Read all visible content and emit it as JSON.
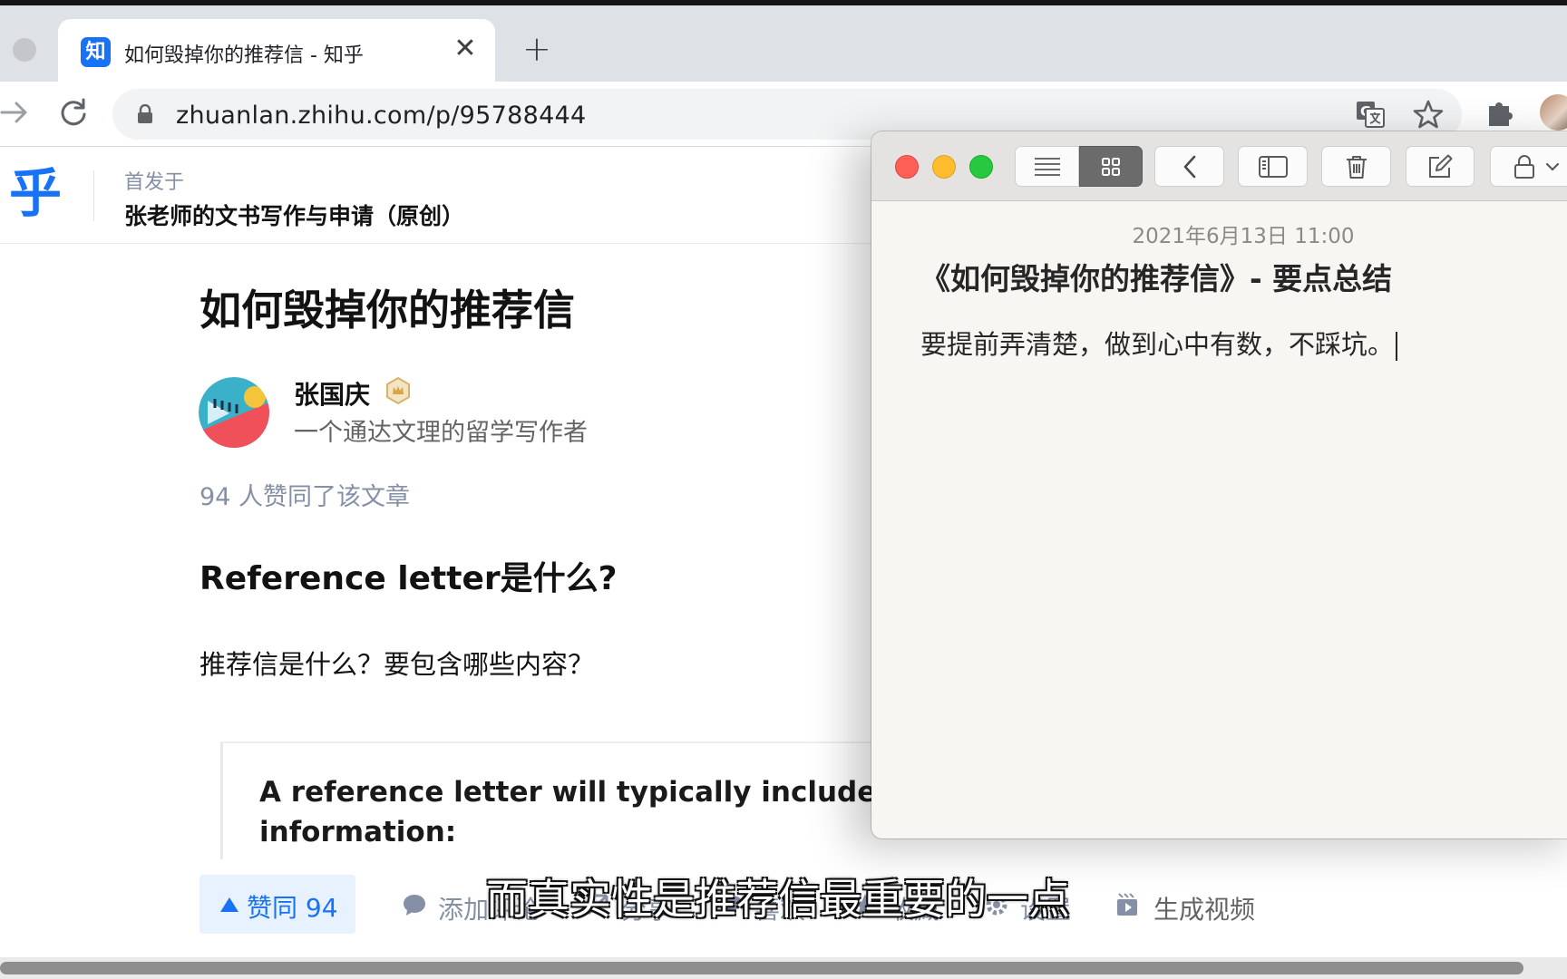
{
  "browser": {
    "tab": {
      "favicon_text": "知",
      "title": "如何毁掉你的推荐信 - 知乎",
      "close_glyph": "✕",
      "new_tab_glyph": "+"
    },
    "url": "zhuanlan.zhihu.com/p/95788444"
  },
  "zhihu": {
    "logo": "乎",
    "published_label": "首发于",
    "column_name": "张老师的文书写作与申请（原创）",
    "article_title": "如何毁掉你的推荐信",
    "author": {
      "name": "张国庆",
      "bio": "一个通达文理的留学写作者"
    },
    "vote_summary": "94 人赞同了该文章",
    "section_heading": "Reference letter是什么?",
    "paragraph": "推荐信是什么？要包含哪些内容？",
    "embedded_text_line1": "A reference letter will typically include the f",
    "embedded_text_line2": "information:",
    "actions": {
      "upvote": "赞同 94",
      "comment": "添加评论",
      "share": "分享",
      "like": "喜欢",
      "favorite": "收藏",
      "settings": "设置",
      "generate_video": "生成视频"
    }
  },
  "video_subtitle": "而真实性是推荐信最重要的一点",
  "notes": {
    "date": "2021年6月13日 11:00",
    "title": "《如何毁掉你的推荐信》- 要点总结",
    "body": "要提前弄清楚，做到心中有数，不踩坑。"
  },
  "colors": {
    "zhihu_blue": "#1772f6",
    "upvote_bg": "#e8f1fe",
    "muted_text": "#8590a6",
    "mac_red": "#fe5f57",
    "mac_yellow": "#febc2e",
    "mac_green": "#28c840"
  }
}
